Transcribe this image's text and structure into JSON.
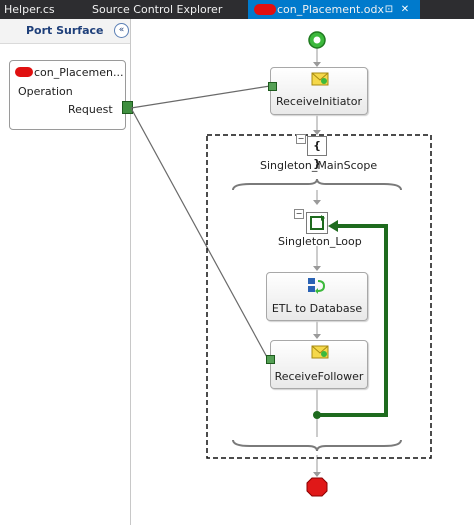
{
  "tabs": [
    {
      "label": "Helper.cs"
    },
    {
      "label": "Source Control Explorer"
    },
    {
      "label": "con_Placement.odx",
      "active": true
    }
  ],
  "tab_buttons": {
    "pin": "⊡",
    "close": "✕"
  },
  "port_surface": {
    "title": "Port Surface",
    "collapse": "«",
    "port": {
      "name": "con_Placemen...",
      "operation": "Operation",
      "request": "Request"
    }
  },
  "shapes": {
    "receive_initiator": "ReceiveInitiator",
    "main_scope": "Singleton_MainScope",
    "main_scope_icon": "{ }",
    "loop": "Singleton_Loop",
    "etl": "ETL to Database",
    "receive_follower": "ReceiveFollower"
  },
  "colors": {
    "tab_bg": "#2d2d30",
    "tab_active": "#007acc",
    "start": "#3cb93c",
    "end": "#e01818",
    "loop_arrow": "#1e6b1e",
    "port_link": "#6a6a6a"
  },
  "icons": [
    "receive-icon",
    "loop-icon",
    "expression-icon",
    "start-icon",
    "end-icon"
  ]
}
